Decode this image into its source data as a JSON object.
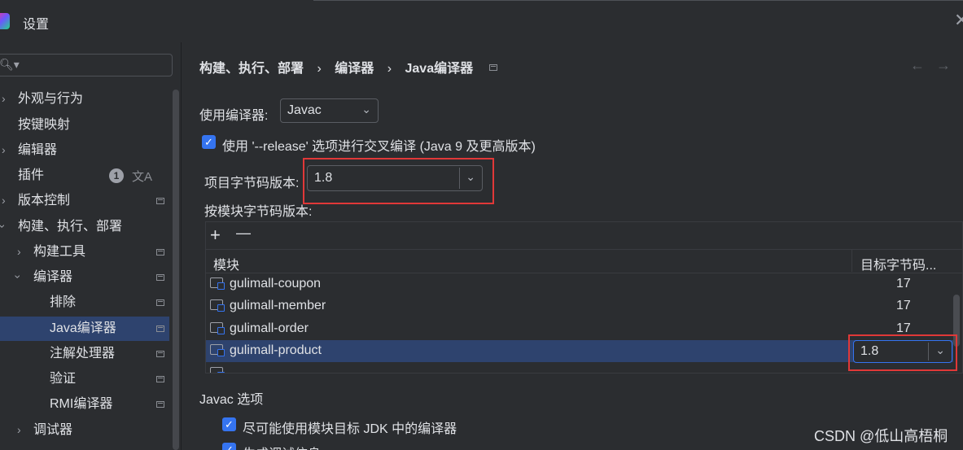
{
  "window": {
    "title": "设置"
  },
  "search": {
    "placeholder": ""
  },
  "sidebar": {
    "items": [
      {
        "label": "外观与行为"
      },
      {
        "label": "按键映射"
      },
      {
        "label": "编辑器"
      },
      {
        "label": "插件"
      },
      {
        "label": "版本控制"
      },
      {
        "label": "构建、执行、部署"
      },
      {
        "label": "构建工具"
      },
      {
        "label": "编译器"
      },
      {
        "label": "排除"
      },
      {
        "label": "Java编译器"
      },
      {
        "label": "注解处理器"
      },
      {
        "label": "验证"
      },
      {
        "label": "RMI编译器"
      },
      {
        "label": "调试器"
      }
    ],
    "plugins_badge": "1"
  },
  "breadcrumb": {
    "part1": "构建、执行、部署",
    "sep": "›",
    "part2": "编译器",
    "part3": "Java编译器"
  },
  "compiler": {
    "label": "使用编译器:",
    "value": "Javac"
  },
  "release_option": {
    "label": "使用 '--release' 选项进行交叉编译 (Java 9 及更高版本)",
    "checked": true
  },
  "project_bytecode": {
    "label": "项目字节码版本:",
    "value": "1.8"
  },
  "per_module": {
    "label": "按模块字节码版本:"
  },
  "table": {
    "toolbar": {
      "add": "+",
      "remove": "—"
    },
    "headers": {
      "module": "模块",
      "target": "目标字节码..."
    },
    "rows": [
      {
        "module": "gulimall-coupon",
        "version": "17"
      },
      {
        "module": "gulimall-member",
        "version": "17"
      },
      {
        "module": "gulimall-order",
        "version": "17"
      },
      {
        "module": "gulimall-product",
        "version": "1.8"
      }
    ]
  },
  "javac_options": {
    "section": "Javac 选项",
    "opt1": "尽可能使用模块目标 JDK 中的编译器",
    "opt2": "生成调试信息"
  },
  "watermark": "CSDN @低山高梧桐",
  "colors": {
    "background": "#2b2d30",
    "selection": "#2e436e",
    "accent": "#3574f0",
    "highlight_box": "#e03838"
  }
}
